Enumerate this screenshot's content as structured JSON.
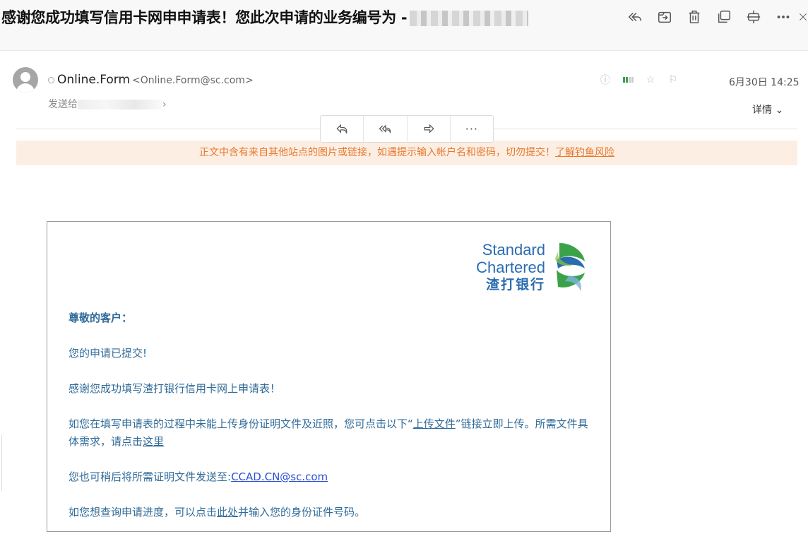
{
  "header": {
    "subject": "感谢您成功填写信用卡网申申请表！您此次申请的业务编号为 -",
    "toolbar_icons": [
      "reply-all-icon",
      "move-icon",
      "trash-icon",
      "copy-window-icon",
      "fold-icon",
      "more-icon"
    ]
  },
  "sender": {
    "name": "Online.Form",
    "email": "<Online.Form@sc.com>",
    "sendto_label": "发送给",
    "date": "6月30日 14:25",
    "detail_label": "详情"
  },
  "actions": {
    "more": "···"
  },
  "warning": {
    "text": "正文中含有来自其他站点的图片或链接，如遇提示输入帐户名和密码，切勿提交！",
    "link": "了解钓鱼风险"
  },
  "body": {
    "logo": {
      "line1": "Standard",
      "line2": "Chartered",
      "line3": "渣打银行",
      "colors": {
        "blue": "#2b6cb0",
        "green": "#3aa34a"
      }
    },
    "greeting": "尊敬的客户：",
    "p1": "您的申请已提交!",
    "p2": "感谢您成功填写渣打银行信用卡网上申请表！",
    "p3_a": "如您在填写申请表的过程中未能上传身份证明文件及近照，您可点击以下“",
    "p3_link": "上传文件",
    "p3_b": "”链接立即上传。所需文件具体需求，请点击",
    "p3_link2": "这里",
    "p4_a": "您也可稍后将所需证明文件发送至:",
    "p4_mail": "CCAD.CN@sc.com",
    "p5_a": "如您想查询申请进度，可以点击",
    "p5_link": "此处",
    "p5_b": "并输入您的身份证件号码。"
  }
}
